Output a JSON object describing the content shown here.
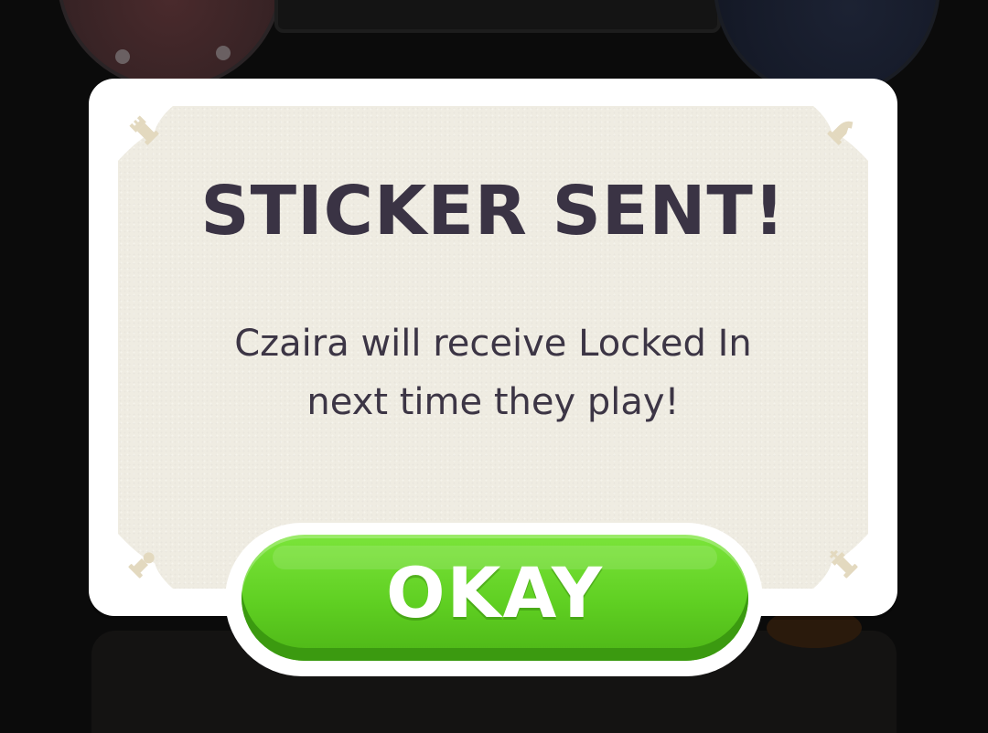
{
  "dialog": {
    "title": "STICKER SENT!",
    "message_line1": "Czaira will receive Locked In",
    "message_line2": "next time they play!",
    "ok_label": "OKAY"
  },
  "colors": {
    "overlay": "#0b0b0b",
    "dialog_border": "#ffffff",
    "dialog_panel": "#efece2",
    "text": "#3a3344",
    "button_green": "#5fcf22",
    "button_text": "#ffffff",
    "corner_ornament": "#e6dcc4"
  },
  "icons": {
    "corner_ornament": "chess-piece-corner-icon"
  }
}
